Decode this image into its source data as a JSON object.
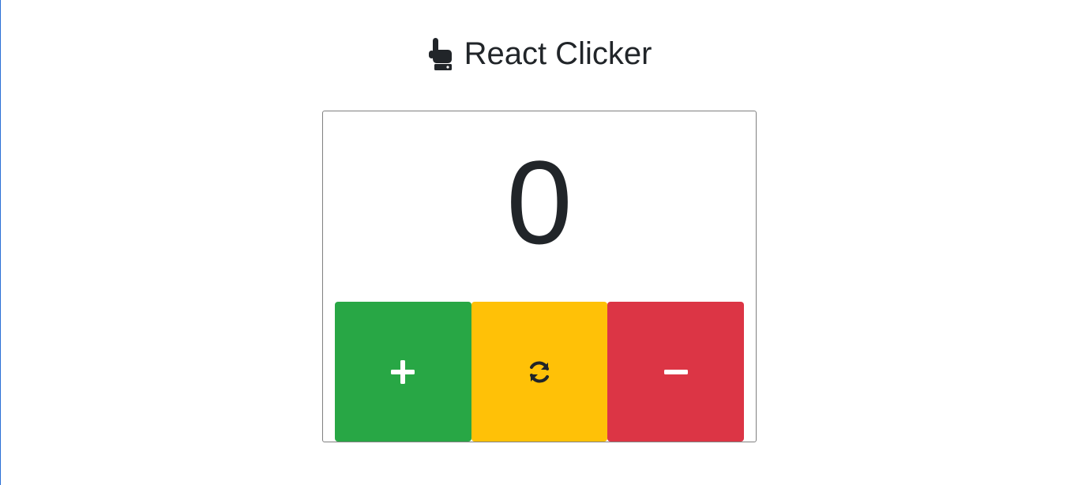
{
  "header": {
    "title": "React Clicker",
    "icon": "hand-pointer-icon"
  },
  "counter": {
    "value": "0"
  },
  "buttons": [
    {
      "name": "increment-button",
      "icon": "plus-icon",
      "color": "#28a745"
    },
    {
      "name": "reset-button",
      "icon": "refresh-icon",
      "color": "#ffc107"
    },
    {
      "name": "decrement-button",
      "icon": "minus-icon",
      "color": "#dc3545"
    }
  ]
}
